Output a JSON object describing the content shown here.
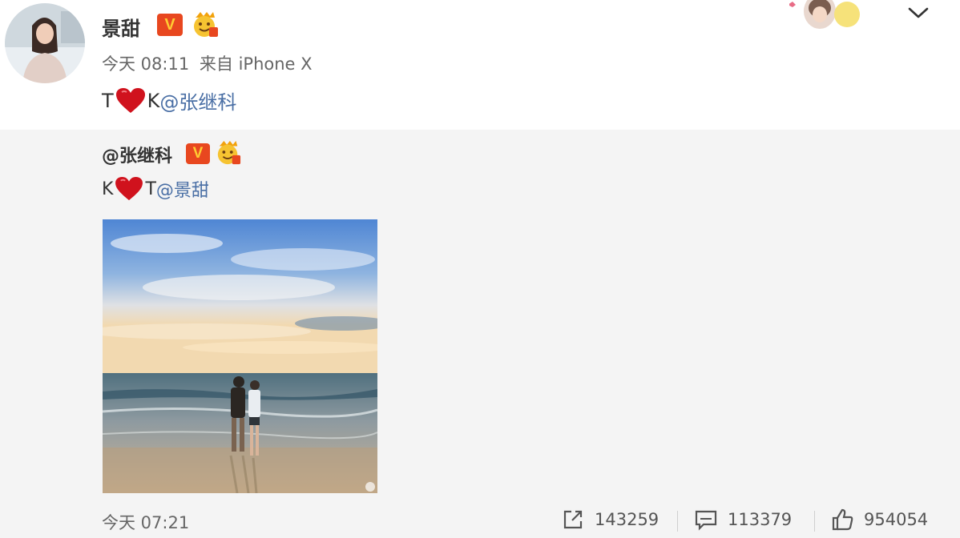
{
  "post": {
    "username": "景甜",
    "verified_badge": "V",
    "time": "今天 08:11",
    "source": "来自 iPhone X",
    "content_prefix": "T",
    "content_middle": "K",
    "mention": "@张继科"
  },
  "repost": {
    "username": "@张继科",
    "verified_badge": "V",
    "content_prefix": "K",
    "content_middle": "T",
    "mention": "@景甜",
    "time": "今天 07:21",
    "share_count": "143259",
    "comment_count": "113379",
    "like_count": "954054"
  },
  "colors": {
    "verified": "#e8471f",
    "heart": "#d0121d",
    "mention": "#4a6fa5",
    "repost_bg": "#f4f4f4"
  },
  "icons": [
    "avatar",
    "verified-v-icon",
    "vip-emoji-icon",
    "heart-icon",
    "chevron-down-icon",
    "share-icon",
    "comment-icon",
    "like-icon"
  ]
}
